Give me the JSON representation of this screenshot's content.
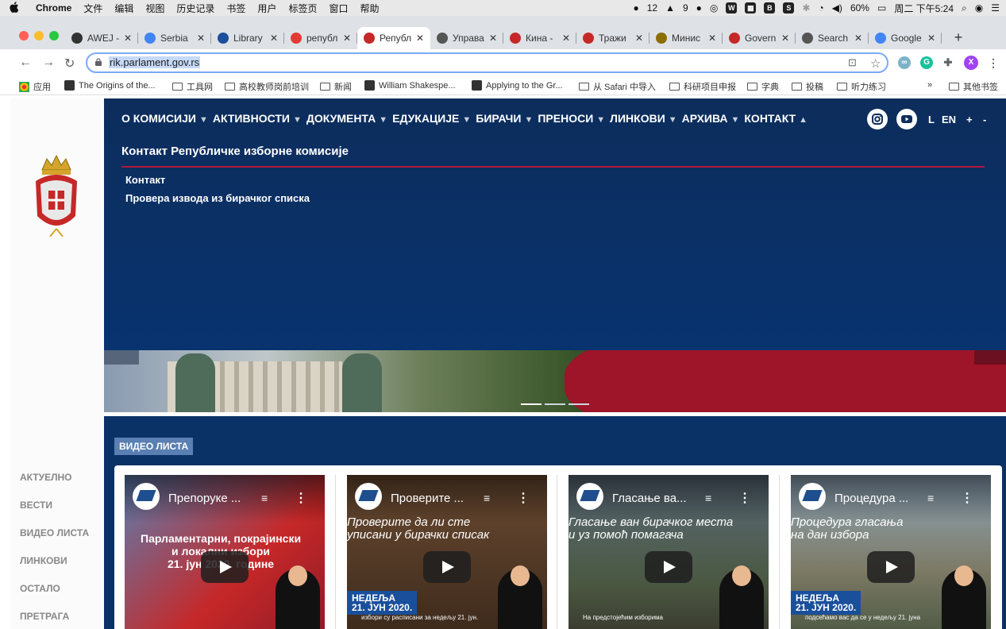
{
  "menubar": {
    "apple": "",
    "items": [
      "Chrome",
      "文件",
      "编辑",
      "视图",
      "历史记录",
      "书签",
      "用户",
      "标签页",
      "窗口",
      "帮助"
    ],
    "wechat_count": "12",
    "notif_count": "9",
    "battery": "60%",
    "clock": "周二 下午5:24"
  },
  "tabs": [
    {
      "label": "AWEJ -",
      "icon": "camera-icon",
      "color": "#333333"
    },
    {
      "label": "Serbia",
      "icon": "google-icon",
      "color": "#4285f4"
    },
    {
      "label": "Library",
      "icon": "library-icon",
      "color": "#1a4f9b"
    },
    {
      "label": "републ",
      "icon": "yandex-icon",
      "color": "#e53935"
    },
    {
      "label": "Републ",
      "icon": "serbia-crest-icon",
      "color": "#c62828",
      "active": true
    },
    {
      "label": "Управа",
      "icon": "globe-icon",
      "color": "#555555"
    },
    {
      "label": "Кина -",
      "icon": "serbia-crest-icon",
      "color": "#c62828"
    },
    {
      "label": "Тражи",
      "icon": "serbia-crest-icon",
      "color": "#c62828"
    },
    {
      "label": "Минис",
      "icon": "ministry-icon",
      "color": "#8d6e00"
    },
    {
      "label": "Govern",
      "icon": "serbia-crest-icon",
      "color": "#c62828"
    },
    {
      "label": "Search",
      "icon": "globe-icon",
      "color": "#555555"
    },
    {
      "label": "Google",
      "icon": "google-translate-icon",
      "color": "#4285f4"
    }
  ],
  "toolbar": {
    "url": "rik.parlament.gov.rs",
    "profile_initial": "X"
  },
  "bookmarks": [
    {
      "label": "应用",
      "kind": "apps"
    },
    {
      "label": "The Origins of the...",
      "kind": "site"
    },
    {
      "label": "工具网",
      "kind": "folder"
    },
    {
      "label": "高校教师岗前培训",
      "kind": "folder"
    },
    {
      "label": "新闻",
      "kind": "folder"
    },
    {
      "label": "William Shakespe...",
      "kind": "site"
    },
    {
      "label": "Applying to the Gr...",
      "kind": "site"
    },
    {
      "label": "从 Safari 中导入",
      "kind": "folder"
    },
    {
      "label": "科研项目申报",
      "kind": "folder"
    },
    {
      "label": "字典",
      "kind": "folder"
    },
    {
      "label": "投稿",
      "kind": "folder"
    },
    {
      "label": "听力练习",
      "kind": "folder"
    },
    {
      "label": "»",
      "kind": "more"
    },
    {
      "label": "其他书签",
      "kind": "folder"
    }
  ],
  "site": {
    "sidebar_nav": [
      "АКТУЕЛНО",
      "ВЕСТИ",
      "ВИДЕО ЛИСТА",
      "ЛИНКОВИ",
      "ОСТАЛО",
      "ПРЕТРАГА"
    ],
    "top_nav": [
      {
        "label": "О КОМИСИЈИ",
        "arrow": "▼"
      },
      {
        "label": "АКТИВНОСТИ",
        "arrow": "▼"
      },
      {
        "label": "ДОКУМЕНТА",
        "arrow": "▼"
      },
      {
        "label": "ЕДУКАЦИЈЕ",
        "arrow": "▼"
      },
      {
        "label": "БИРАЧИ",
        "arrow": "▼"
      },
      {
        "label": "ПРЕНОСИ",
        "arrow": "▼"
      },
      {
        "label": "ЛИНКОВИ",
        "arrow": "▼"
      },
      {
        "label": "АРХИВА",
        "arrow": "▼"
      },
      {
        "label": "КОНТАКТ",
        "arrow": "▲",
        "active": true
      }
    ],
    "lang": {
      "l": "L",
      "en": "EN",
      "plus": "+",
      "minus": "-"
    },
    "dropdown": {
      "title": "Контакт Републичке изборне комисије",
      "links": [
        "Контакт",
        "Провера извода из бирачког списка"
      ]
    },
    "video_section_label": "ВИДЕО ЛИСТА",
    "videos": [
      {
        "title": "Препоруке ...",
        "overlay": "Парламентарни, покрајински\nи локални избори\n21. јун 2020. године",
        "date": "",
        "caption": ""
      },
      {
        "title": "Проверите ...",
        "overlay": "Проверите да ли сте\nуписани у бирачки списак",
        "date": "НЕДЕЉА\n21. ЈУН 2020.",
        "caption": "избори су расписани за недељу 21. јун."
      },
      {
        "title": "Гласање ва...",
        "overlay": "Гласање ван бирачког места\nи уз помоћ помагача",
        "date": "",
        "caption": "На предстојећим изборима"
      },
      {
        "title": "Процедура ...",
        "overlay": "Процедура гласања\nна дан избора",
        "date": "НЕДЕЉА\n21. ЈУН 2020.",
        "caption": "подсећамо вас да се у недељу 21. јуна"
      }
    ]
  }
}
